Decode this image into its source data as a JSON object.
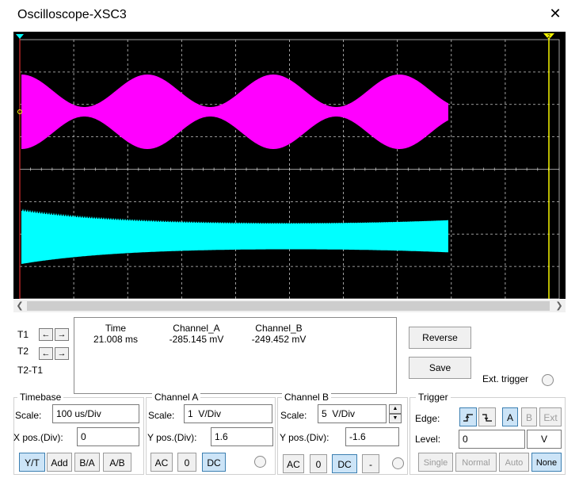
{
  "window": {
    "title": "Oscilloscope-XSC3"
  },
  "colors": {
    "screen_background": "#000000",
    "grid": "#c8c8c8",
    "channel_a_trace": "#ff00ff",
    "channel_b_trace": "#00ffff",
    "cursor_t1": "#e03030",
    "cursor_t2": "#f5f500",
    "active_button": "#cce4f7"
  },
  "cursors": {
    "t1_label": "T1",
    "t2_label": "T2",
    "diff_label": "T2-T1",
    "t2_marker": "2"
  },
  "readout": {
    "headers": [
      "Time",
      "Channel_A",
      "Channel_B"
    ],
    "row1": [
      "21.008 ms",
      "-285.145 mV",
      "-249.452 mV"
    ]
  },
  "buttons": {
    "reverse": "Reverse",
    "save": "Save",
    "ext_trigger": "Ext. trigger"
  },
  "timebase": {
    "title": "Timebase",
    "scale_label": "Scale:",
    "scale_value": "100 us/Div",
    "xpos_label": "X pos.(Div):",
    "xpos_value": "0",
    "modes": [
      "Y/T",
      "Add",
      "B/A",
      "A/B"
    ]
  },
  "channel_a": {
    "title": "Channel A",
    "scale_label": "Scale:",
    "scale_value": "1  V/Div",
    "ypos_label": "Y pos.(Div):",
    "ypos_value": "1.6",
    "coupling": [
      "AC",
      "0",
      "DC"
    ]
  },
  "channel_b": {
    "title": "Channel B",
    "scale_label": "Scale:",
    "scale_value": "5  V/Div",
    "ypos_label": "Y pos.(Div):",
    "ypos_value": "-1.6",
    "coupling": [
      "AC",
      "0",
      "DC",
      "-"
    ]
  },
  "trigger": {
    "title": "Trigger",
    "edge_label": "Edge:",
    "edge_rising": "rising-edge-icon",
    "edge_falling": "falling-edge-icon",
    "sources": [
      "A",
      "B",
      "Ext"
    ],
    "level_label": "Level:",
    "level_value": "0",
    "level_unit": "V",
    "modes": [
      "Single",
      "Normal",
      "Auto",
      "None"
    ]
  }
}
